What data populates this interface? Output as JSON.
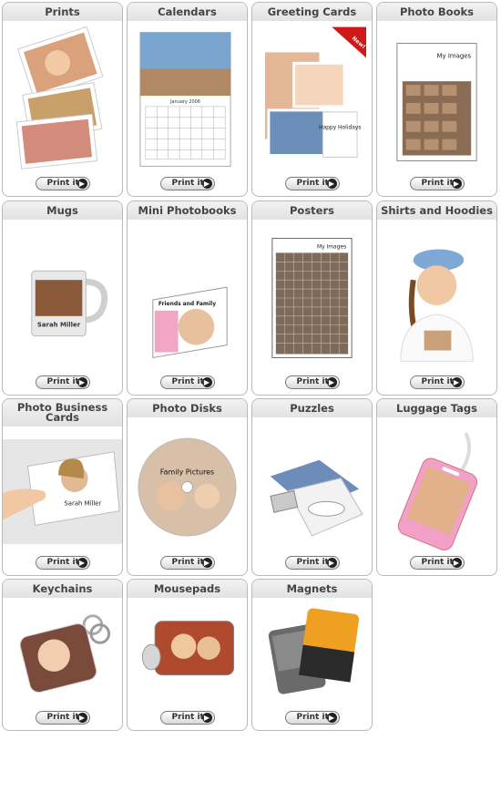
{
  "products": [
    {
      "title": "Prints",
      "icon": "prints-icon"
    },
    {
      "title": "Calendars",
      "icon": "calendar-icon"
    },
    {
      "title": "Greeting Cards",
      "icon": "greeting-card-icon",
      "badge": "New!",
      "card_text": "Happy Holidays"
    },
    {
      "title": "Photo Books",
      "icon": "photo-book-icon",
      "cover_text": "My Images"
    },
    {
      "title": "Mugs",
      "icon": "mug-icon",
      "mug_text": "Sarah Miller"
    },
    {
      "title": "Mini Photobooks",
      "icon": "mini-photobook-icon",
      "cover_text": "Friends and Family"
    },
    {
      "title": "Posters",
      "icon": "poster-icon",
      "poster_text": "My Images"
    },
    {
      "title": "Shirts and Hoodies",
      "icon": "shirt-icon"
    },
    {
      "title": "Photo Business Cards",
      "icon": "business-card-icon",
      "card_text": "Sarah Miller"
    },
    {
      "title": "Photo Disks",
      "icon": "photo-disk-icon",
      "disk_text": "Family Pictures"
    },
    {
      "title": "Puzzles",
      "icon": "puzzle-icon"
    },
    {
      "title": "Luggage Tags",
      "icon": "luggage-tag-icon"
    },
    {
      "title": "Keychains",
      "icon": "keychain-icon"
    },
    {
      "title": "Mousepads",
      "icon": "mousepad-icon"
    },
    {
      "title": "Magnets",
      "icon": "magnet-icon"
    }
  ],
  "calendar_month": "January 2006",
  "button_label": "Print it",
  "button_icon": "arrow-right-icon",
  "colors": {
    "border": "#b9b9b9",
    "header_bg": "#e6e6e6",
    "title_text": "#444444"
  }
}
